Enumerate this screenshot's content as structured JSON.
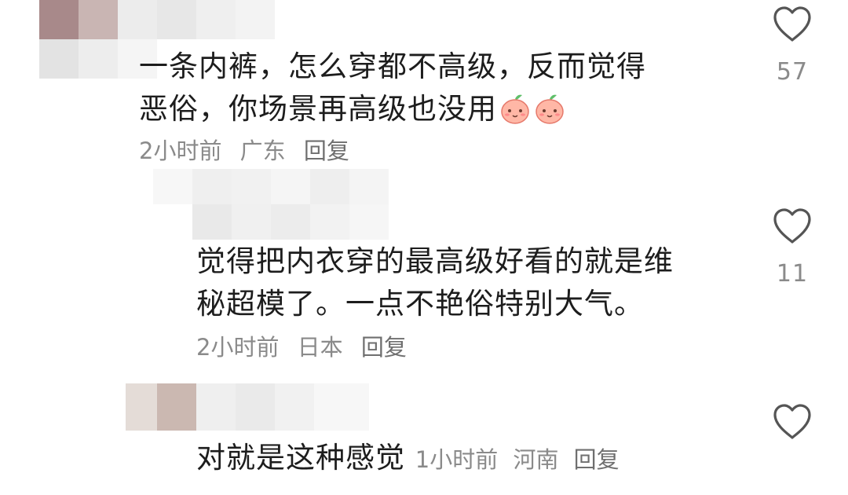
{
  "comments": [
    {
      "lines": [
        "一条内裤，怎么穿都不高级，反而觉得",
        "恶俗，你场景再高级也没用"
      ],
      "emoji_count": 2,
      "time": "2小时前",
      "location": "广东",
      "reply_label": "回复",
      "likes": "57"
    },
    {
      "lines": [
        "觉得把内衣穿的最高级好看的就是维",
        "秘超模了。一点不艳俗特别大气。"
      ],
      "time": "2小时前",
      "location": "日本",
      "reply_label": "回复",
      "likes": "11"
    },
    {
      "text": "对就是这种感觉",
      "time": "1小时前",
      "location": "河南",
      "reply_label": "回复",
      "likes": ""
    }
  ],
  "icons": {
    "like": "heart-outline-icon",
    "emoji": "peach-face-emoji"
  },
  "colors": {
    "text": "#1d1d1d",
    "meta": "#8a8a8a",
    "icon_stroke": "#555555"
  }
}
